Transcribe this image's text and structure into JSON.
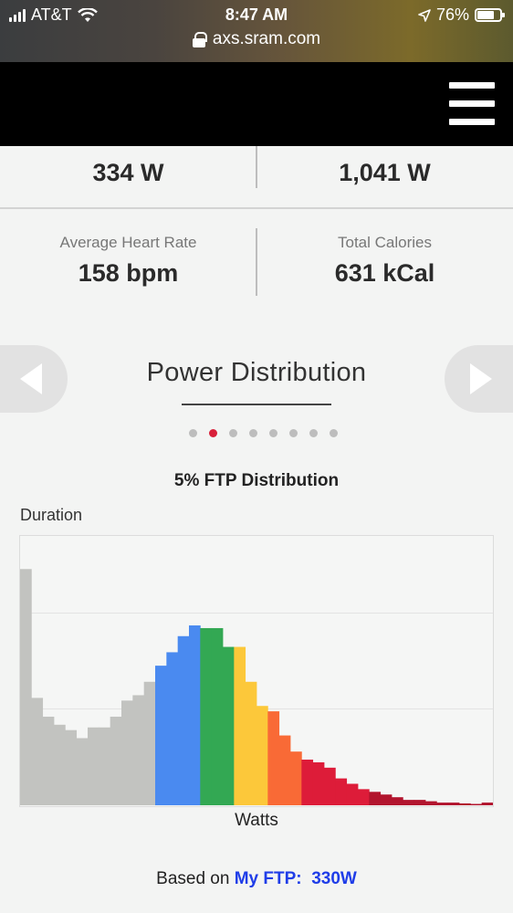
{
  "status_bar": {
    "carrier": "AT&T",
    "time": "8:47 AM",
    "battery": "76%",
    "battery_level": 0.76,
    "url": "axs.sram.com"
  },
  "stats": {
    "row1": {
      "left_value": "334 W",
      "right_value": "1,041 W"
    },
    "row2": {
      "left_label": "Average Heart Rate",
      "left_value": "158 bpm",
      "right_label": "Total Calories",
      "right_value": "631 kCal"
    }
  },
  "section": {
    "title": "Power Distribution",
    "pagination": {
      "count": 8,
      "active_index": 1
    }
  },
  "chart_data": {
    "type": "bar",
    "title": "5% FTP Distribution",
    "ylabel": "Duration",
    "xlabel": "Watts",
    "ylim": [
      0,
      100
    ],
    "grid": true,
    "zone_colors": [
      "#c2c3c0",
      "#4a8af0",
      "#33a853",
      "#fcc83a",
      "#f96a36",
      "#dd1c39",
      "#b2152e"
    ],
    "values": [
      88,
      40,
      33,
      30,
      28,
      25,
      29,
      29,
      33,
      39,
      41,
      46,
      52,
      57,
      63,
      67,
      66,
      66,
      59,
      59,
      46,
      37,
      35,
      26,
      20,
      17,
      16,
      14,
      10,
      8,
      6,
      5,
      4,
      3,
      2,
      2,
      1.5,
      1,
      1,
      0.7,
      0.5,
      1
    ],
    "zones": [
      0,
      0,
      0,
      0,
      0,
      0,
      0,
      0,
      0,
      0,
      0,
      0,
      1,
      1,
      1,
      1,
      2,
      2,
      2,
      3,
      3,
      3,
      4,
      4,
      4,
      5,
      5,
      5,
      5,
      5,
      5,
      6,
      6,
      6,
      6,
      6,
      6,
      6,
      6,
      6,
      6,
      6
    ]
  },
  "footer": {
    "prefix": "Based on",
    "ftp_label": "My FTP:",
    "ftp_value": "330W"
  }
}
